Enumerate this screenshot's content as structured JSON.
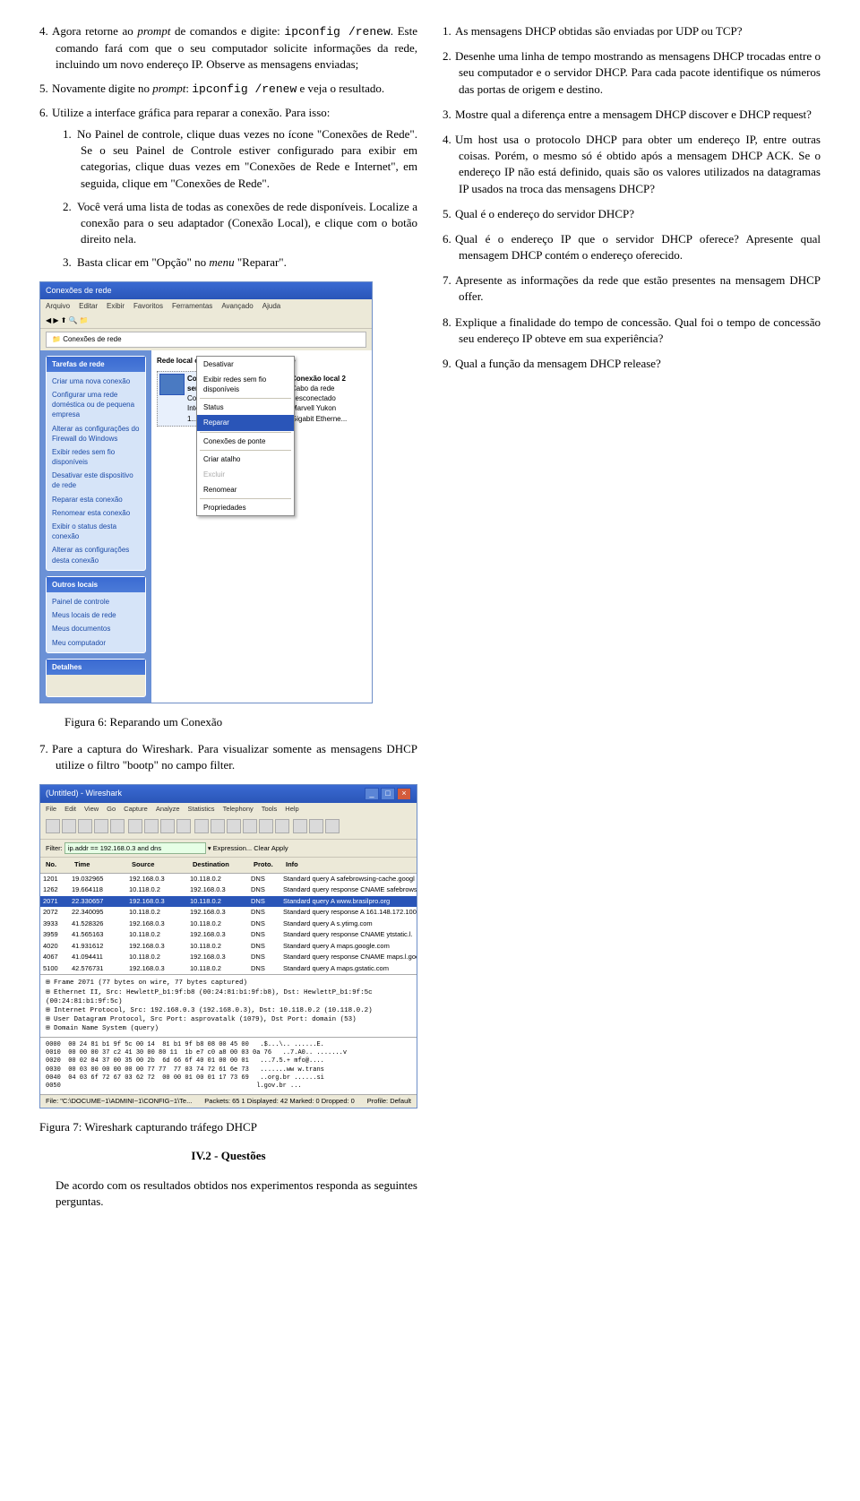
{
  "left": {
    "item4": {
      "n": "4.",
      "text_a": "Agora retorne ao ",
      "it1": "prompt",
      "text_b": " de comandos e digite: ",
      "tt1": "ipconfig /renew",
      "text_c": ". Este comando fará com que o seu computador solicite informações da rede, incluindo um novo endereço IP. Observe as mensagens enviadas;"
    },
    "item5": {
      "n": "5.",
      "text_a": "Novamente digite no ",
      "it1": "prompt",
      "text_b": ": ",
      "tt1": "ipconfig /renew",
      "text_c": " e veja o resultado."
    },
    "item6": {
      "n": "6.",
      "text": "Utilize a interface gráfica para reparar a conexão. Para isso:"
    },
    "sub": [
      {
        "n": "1.",
        "text": "No Painel de controle, clique duas vezes no ícone \"Conexões de Rede\". Se o seu Painel de Controle estiver configurado para exibir em categorias, clique duas vezes em \"Conexões de Rede e Internet\", em seguida, clique em \"Conexões de Rede\"."
      },
      {
        "n": "2.",
        "text": "Você verá uma lista de todas as conexões de rede disponíveis. Localize a conexão para o seu adaptador (Conexão Local), e clique com o botão direito nela."
      },
      {
        "n": "3.",
        "text_a": "Basta clicar em \"Opção\" no ",
        "it1": "menu",
        "text_b": " \"Reparar\"."
      }
    ],
    "fig6cap": "Figura 6: Reparando um Conexão",
    "item7": {
      "n": "7.",
      "text": "Pare a captura do Wireshark. Para visualizar somente as mensagens DHCP utilize o filtro \"bootp\" no campo filter."
    },
    "fig7cap": "Figura 7: Wireshark capturando tráfego DHCP",
    "section": "IV.2 - Questões",
    "after": "De acordo com os resultados obtidos nos experimentos responda as seguintes perguntas."
  },
  "q": [
    {
      "n": "1.",
      "text": "As mensagens DHCP obtidas são enviadas por UDP ou TCP?"
    },
    {
      "n": "2.",
      "text": "Desenhe uma linha de tempo mostrando as mensagens DHCP trocadas entre o seu computador e o servidor DHCP. Para cada pacote identifique os números das portas de origem e destino."
    },
    {
      "n": "3.",
      "text": "Mostre qual a diferença entre a mensagem DHCP discover e DHCP request?"
    },
    {
      "n": "4.",
      "text": "Um host usa o protocolo DHCP para obter um endereço IP, entre outras coisas. Porém, o mesmo só é obtido após a mensagem DHCP ACK. Se o endereço IP não está definido, quais são os valores utilizados na datagramas IP usados na troca das mensagens DHCP?"
    },
    {
      "n": "5.",
      "text": "Qual é o endereço do servidor DHCP?"
    },
    {
      "n": "6.",
      "text": "Qual é o endereço IP que o servidor DHCP oferece? Apresente qual mensagem DHCP contém o endereço oferecido."
    },
    {
      "n": "7.",
      "text": "Apresente as informações da rede que estão presentes na mensagem DHCP offer."
    },
    {
      "n": "8.",
      "text": "Explique a finalidade do tempo de concessão. Qual foi o tempo de concessão seu endereço IP obteve em sua experiência?"
    },
    {
      "n": "9.",
      "text": "Qual a função da mensagem DHCP release?"
    }
  ],
  "f6": {
    "title": "Conexões de rede",
    "menu": [
      "Arquivo",
      "Editar",
      "Exibir",
      "Favoritos",
      "Ferramentas",
      "Avançado",
      "Ajuda"
    ],
    "addr": "Conexões de rede",
    "panel1": {
      "h": "Tarefas de rede",
      "items": [
        "Criar uma nova conexão",
        "Configurar uma rede doméstica ou de pequena empresa",
        "Alterar as configurações do Firewall do Windows",
        "Exibir redes sem fio disponíveis",
        "Desativar este dispositivo de rede",
        "Reparar esta conexão",
        "Renomear esta conexão",
        "Exibir o status desta conexão",
        "Alterar as configurações desta conexão"
      ]
    },
    "panel2": {
      "h": "Outros locais",
      "items": [
        "Painel de controle",
        "Meus locais de rede",
        "Meus documentos",
        "Meu computador"
      ]
    },
    "panel3": {
      "h": "Detalhes"
    },
    "group": "Rede local ou Internet de alta velocidade",
    "conn1": {
      "t": "Conexão de rede sem fio 3",
      "s": "Conectado",
      "d": "Intel(R) WiFi Link 1..."
    },
    "conn2": {
      "t": "Conexão local 2",
      "s": "Cabo da rede desconectado",
      "d": "Marvell Yukon Gigabit Etherne..."
    },
    "ctx": [
      "Desativar",
      "Exibir redes sem fio disponíveis",
      "Status",
      "Reparar",
      "Conexões de ponte",
      "Criar atalho",
      "Excluir",
      "Renomear",
      "Propriedades"
    ]
  },
  "f7": {
    "title": "(Untitled) - Wireshark",
    "menu": [
      "File",
      "Edit",
      "View",
      "Go",
      "Capture",
      "Analyze",
      "Statistics",
      "Telephony",
      "Tools",
      "Help"
    ],
    "filterlabel": "Filter:",
    "filterval": "ip.addr == 192.168.0.3 and dns",
    "expr": "Expression...",
    "clear": "Clear",
    "apply": "Apply",
    "hdr": [
      "No.",
      "Time",
      "Source",
      "Destination",
      "Proto.",
      "Info"
    ],
    "rows": [
      [
        "1201",
        "19.032965",
        "192.168.0.3",
        "10.118.0.2",
        "DNS",
        "Standard query A safebrowsing-cache.googl"
      ],
      [
        "1262",
        "19.664118",
        "10.118.0.2",
        "192.168.0.3",
        "DNS",
        "Standard query response CNAME safebrowsi"
      ],
      [
        "2071",
        "22.330657",
        "192.168.0.3",
        "10.118.0.2",
        "DNS",
        "Standard query A www.brasilpro.org"
      ],
      [
        "2072",
        "22.340095",
        "10.118.0.2",
        "192.168.0.3",
        "DNS",
        "Standard query response A 161.148.172.100"
      ],
      [
        "3933",
        "41.528326",
        "192.168.0.3",
        "10.118.0.2",
        "DNS",
        "Standard query A s.ytimg.com"
      ],
      [
        "3959",
        "41.565163",
        "10.118.0.2",
        "192.168.0.3",
        "DNS",
        "Standard query response CNAME ytstatic.l."
      ],
      [
        "4020",
        "41.931612",
        "192.168.0.3",
        "10.118.0.2",
        "DNS",
        "Standard query A maps.google.com"
      ],
      [
        "4067",
        "41.094411",
        "10.118.0.2",
        "192.168.0.3",
        "DNS",
        "Standard query response CNAME maps.l.goog"
      ],
      [
        "5100",
        "42.576731",
        "192.168.0.3",
        "10.118.0.2",
        "DNS",
        "Standard query A maps.gstatic.com"
      ]
    ],
    "tree": [
      "⊞ Frame 2071 (77 bytes on wire, 77 bytes captured)",
      "⊞ Ethernet II, Src: HewlettP_b1:9f:b8 (00:24:81:b1:9f:b8), Dst: HewlettP_b1:9f:5c (00:24:81:b1:9f:5c)",
      "⊞ Internet Protocol, Src: 192.168.0.3 (192.168.0.3), Dst: 10.118.0.2 (10.118.0.2)",
      "⊞ User Datagram Protocol, Src Port: asprovatalk (1079), Dst Port: domain (53)",
      "⊞ Domain Name System (query)"
    ],
    "hex": "0000  00 24 81 b1 9f 5c 00 14  81 b1 9f b8 08 00 45 00   .$...\\.. ......E.\n0010  00 00 00 37 c2 41 30 00 80 11  1b e7 c0 a8 00 03 0a 76   ..7.A0.. .......v\n0020  00 02 04 37 00 35 00 2b  6d 66 6f 40 01 00 00 01   ...7.5.+ mfo@....\n0030  00 03 00 00 00 00 00 77 77  77 03 74 72 61 6e 73   .......ww w.trans\n0040  04 03 6f 72 67 03 62 72  00 00 01 00 01 17 73 69   ..org.br ......si\n0050                                                    l.gov.br ...",
    "status_l": "File: \"C:\\DOCUME~1\\ADMINI~1\\CONFIG~1\\Te...",
    "status_m": "Packets: 65 1 Displayed: 42 Marked: 0 Dropped: 0",
    "status_r": "Profile: Default"
  }
}
